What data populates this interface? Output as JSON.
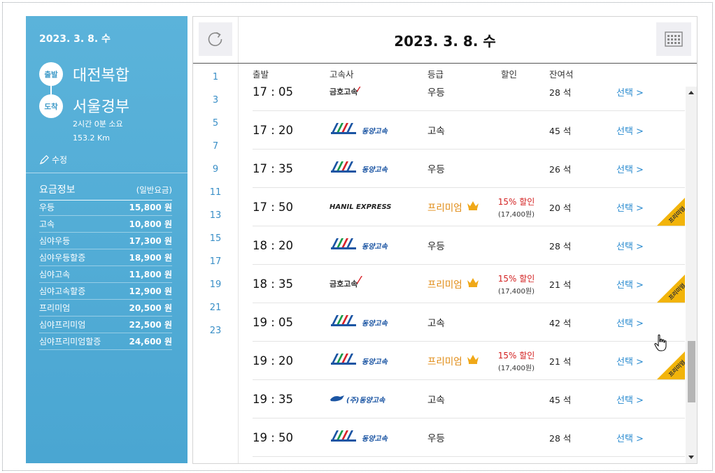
{
  "left": {
    "date": "2023. 3. 8. 수",
    "departure_label": "출발",
    "departure": "대전복합",
    "arrival_label": "도착",
    "arrival": "서울경부",
    "duration": "2시간 0분 소요",
    "distance": "153.2 Km",
    "edit_label": "수정",
    "fare_title": "요금정보",
    "fare_subtitle": "(일반요금)",
    "fares": [
      {
        "name": "우등",
        "price": "15,800 원"
      },
      {
        "name": "고속",
        "price": "10,800 원"
      },
      {
        "name": "심야우등",
        "price": "17,300 원"
      },
      {
        "name": "심야우등할증",
        "price": "18,900 원"
      },
      {
        "name": "심야고속",
        "price": "11,800 원"
      },
      {
        "name": "심야고속할증",
        "price": "12,900 원"
      },
      {
        "name": "프리미엄",
        "price": "20,500 원"
      },
      {
        "name": "심야프리미엄",
        "price": "22,500 원"
      },
      {
        "name": "심야프리미엄할증",
        "price": "24,600 원"
      }
    ]
  },
  "right": {
    "date": "2023. 3. 8. 수",
    "hours": [
      "1",
      "3",
      "5",
      "7",
      "9",
      "11",
      "13",
      "15",
      "17",
      "19",
      "21",
      "23"
    ],
    "columns": {
      "depart": "출발",
      "company": "고속사",
      "grade": "등급",
      "discount": "할인",
      "seats": "잔여석"
    },
    "select_label": "선택 >",
    "ribbon_label": "프리미엄",
    "rows": [
      {
        "time": "17 : 05",
        "company": "금호고속",
        "logo": "kumho",
        "grade": "우등",
        "premium": false,
        "discount": "",
        "discount_price": "",
        "seats": "28 석"
      },
      {
        "time": "17 : 20",
        "company": "동양고속",
        "logo": "dongyang",
        "grade": "고속",
        "premium": false,
        "discount": "",
        "discount_price": "",
        "seats": "45 석"
      },
      {
        "time": "17 : 35",
        "company": "동양고속",
        "logo": "dongyang",
        "grade": "우등",
        "premium": false,
        "discount": "",
        "discount_price": "",
        "seats": "26 석"
      },
      {
        "time": "17 : 50",
        "company": "HANIL EXPRESS",
        "logo": "hanil",
        "grade": "프리미엄",
        "premium": true,
        "discount": "15% 할인",
        "discount_price": "(17,400원)",
        "seats": "20 석"
      },
      {
        "time": "18 : 20",
        "company": "동양고속",
        "logo": "dongyang",
        "grade": "우등",
        "premium": false,
        "discount": "",
        "discount_price": "",
        "seats": "28 석"
      },
      {
        "time": "18 : 35",
        "company": "금호고속",
        "logo": "kumho",
        "grade": "프리미엄",
        "premium": true,
        "discount": "15% 할인",
        "discount_price": "(17,400원)",
        "seats": "21 석"
      },
      {
        "time": "19 : 05",
        "company": "동양고속",
        "logo": "dongyang",
        "grade": "고속",
        "premium": false,
        "discount": "",
        "discount_price": "",
        "seats": "42 석"
      },
      {
        "time": "19 : 20",
        "company": "동양고속",
        "logo": "dongyang",
        "grade": "프리미엄",
        "premium": true,
        "discount": "15% 할인",
        "discount_price": "(17,400원)",
        "seats": "21 석"
      },
      {
        "time": "19 : 35",
        "company": "(주)동양고속",
        "logo": "dongyang2",
        "grade": "고속",
        "premium": false,
        "discount": "",
        "discount_price": "",
        "seats": "45 석"
      },
      {
        "time": "19 : 50",
        "company": "동양고속",
        "logo": "dongyang",
        "grade": "우등",
        "premium": false,
        "discount": "",
        "discount_price": "",
        "seats": "28 석"
      }
    ]
  },
  "icons": {
    "refresh": "refresh-icon",
    "calendar": "calendar-icon",
    "edit": "pencil-icon",
    "crown": "crown-icon",
    "cursor": "hand-cursor-icon"
  },
  "colors": {
    "panel": "#4aa6d2",
    "link": "#2a8bd0",
    "premium": "#e08a12",
    "discount": "#d32222",
    "ribbon": "#f2b40a"
  }
}
